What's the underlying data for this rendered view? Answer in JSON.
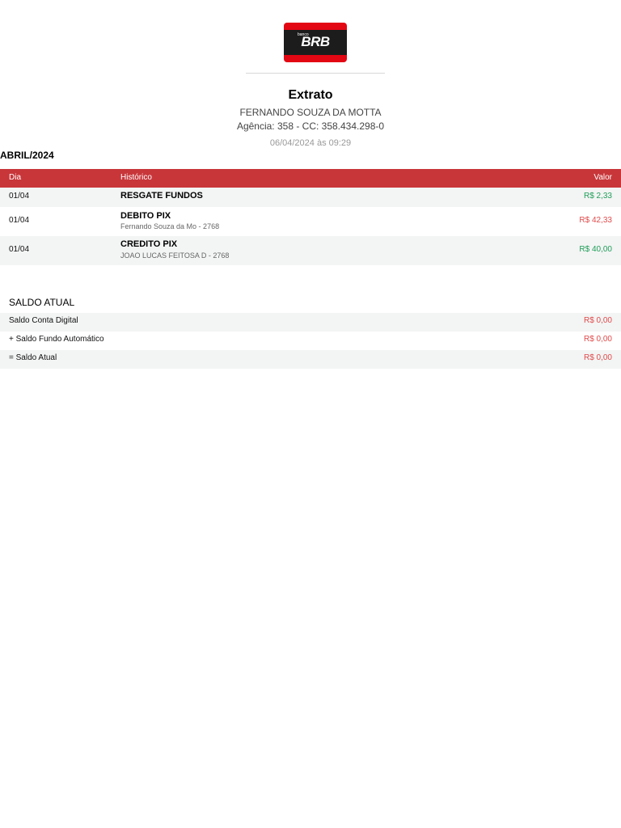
{
  "logo": {
    "brand": "BRB",
    "banco": "banco",
    "colors": {
      "primary": "#e30613",
      "band": "#1c1c1c"
    }
  },
  "header": {
    "title": "Extrato",
    "holder_name": "FERNANDO SOUZA DA MOTTA",
    "account": "Agência: 358 - CC: 358.434.298-0",
    "timestamp": "06/04/2024 às 09:29"
  },
  "period": {
    "label": "ABRIL/2024"
  },
  "table": {
    "headers": {
      "day": "Dia",
      "history": "Histórico",
      "value": "Valor"
    },
    "header_color": "#c8363a",
    "rows": [
      {
        "day": "01/04",
        "title": "RESGATE FUNDOS",
        "detail": "",
        "value": "R$ 2,33",
        "type": "credit"
      },
      {
        "day": "01/04",
        "title": "DEBITO PIX",
        "detail": "Fernando Souza da Mo - 2768",
        "value": "R$ 42,33",
        "type": "debit"
      },
      {
        "day": "01/04",
        "title": "CREDITO PIX",
        "detail": "JOAO LUCAS FEITOSA D - 2768",
        "value": "R$ 40,00",
        "type": "credit"
      }
    ]
  },
  "balance": {
    "title": "SALDO ATUAL",
    "rows": [
      {
        "label": "Saldo Conta Digital",
        "value": "R$ 0,00"
      },
      {
        "label": "+ Saldo Fundo Automático",
        "value": "R$ 0,00"
      },
      {
        "label": "= Saldo Atual",
        "value": "R$ 0,00"
      }
    ]
  },
  "colors": {
    "credit": "#1e9e58",
    "debit": "#e04a4a"
  }
}
